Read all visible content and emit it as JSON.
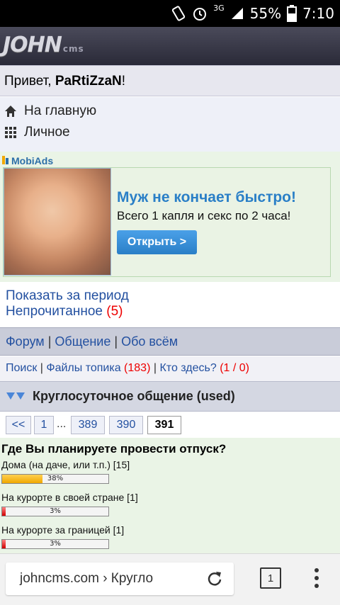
{
  "statusbar": {
    "battery": "55%",
    "time": "7:10",
    "network": "3G"
  },
  "site": {
    "logo_main": "JOHN",
    "logo_sub": "cms"
  },
  "greeting": {
    "prefix": "Привет, ",
    "user": "PaRtiZzaN",
    "suffix": "!"
  },
  "menu": {
    "home": "На главную",
    "personal": "Личное"
  },
  "ad": {
    "brand": "MobiAds",
    "title": "Муж не кончает быстро!",
    "text": "Всего 1 капля и секс по 2 часа!",
    "button": "Открыть >"
  },
  "links": {
    "period": "Показать за период",
    "unread": "Непрочитанное",
    "unread_count": "(5)"
  },
  "breadcrumbs": [
    "Форум",
    "Общение",
    "Обо всём"
  ],
  "tools": {
    "search": "Поиск",
    "files": "Файлы топика",
    "files_count": "(183)",
    "who": "Кто здесь?",
    "who_count": "(1 / 0)"
  },
  "topic": {
    "title": "Круглосуточное общение (used)"
  },
  "pager": {
    "first": "<<",
    "p1": "1",
    "ellipsis": "...",
    "p389": "389",
    "p390": "390",
    "p391": "391",
    "current": "391"
  },
  "poll": {
    "question": "Где Вы планируете провести отпуск?",
    "options": [
      {
        "label": "Дома (на даче, или т.п.) [15]",
        "percent": 38,
        "percent_label": "38%"
      },
      {
        "label": "На курорте в своей стране [1]",
        "percent": 3,
        "percent_label": "3%"
      },
      {
        "label": "На курорте за границей [1]",
        "percent": 3,
        "percent_label": "3%"
      }
    ]
  },
  "browser": {
    "url": "johncms.com › Кругло",
    "tabs_count": "1"
  }
}
